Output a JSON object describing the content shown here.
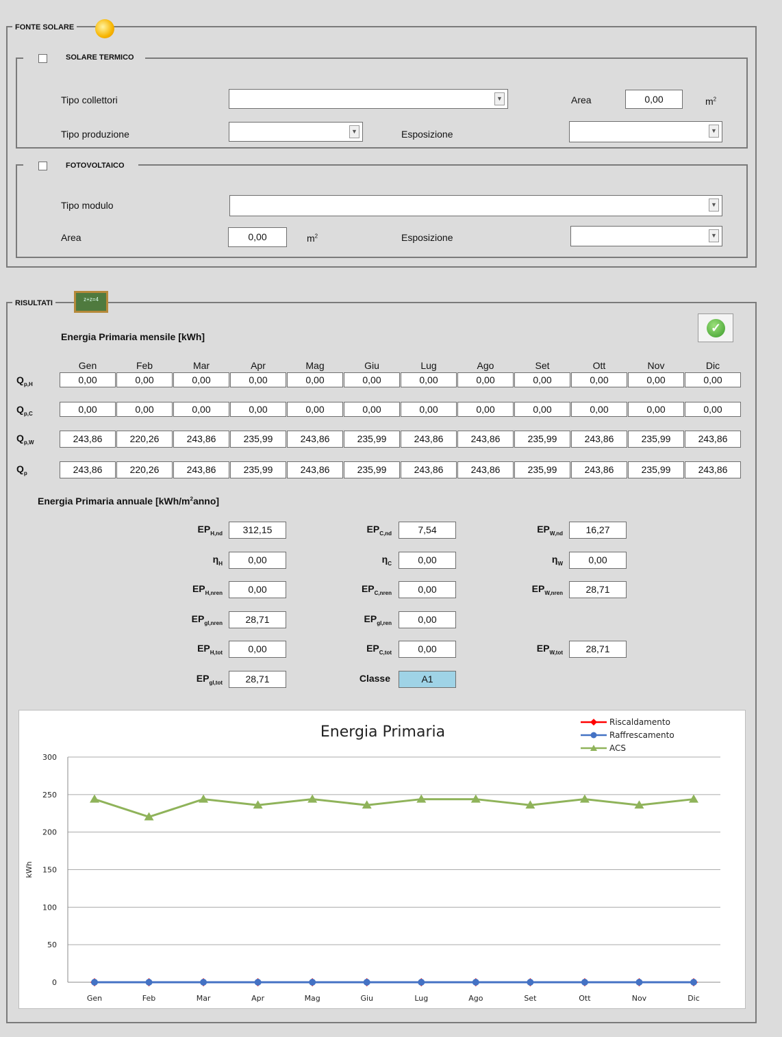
{
  "solar": {
    "section_label": "FONTE SOLARE",
    "termico": {
      "label": "SOLARE TERMICO",
      "tipo_collettori_label": "Tipo collettori",
      "tipo_produzione_label": "Tipo produzione",
      "area_label": "Area",
      "area_value": "0,00",
      "area_unit": "m",
      "esposizione_label": "Esposizione"
    },
    "fotovoltaico": {
      "label": "FOTOVOLTAICO",
      "tipo_modulo_label": "Tipo modulo",
      "area_label": "Area",
      "area_value": "0,00",
      "area_unit": "m",
      "esposizione_label": "Esposizione"
    }
  },
  "results": {
    "section_label": "RISULTATI",
    "monthly_title": "Energia Primaria mensile [kWh]",
    "months": [
      "Gen",
      "Feb",
      "Mar",
      "Apr",
      "Mag",
      "Giu",
      "Lug",
      "Ago",
      "Set",
      "Ott",
      "Nov",
      "Dic"
    ],
    "rows": [
      {
        "label": "Q",
        "sub": "p,H",
        "values": [
          "0,00",
          "0,00",
          "0,00",
          "0,00",
          "0,00",
          "0,00",
          "0,00",
          "0,00",
          "0,00",
          "0,00",
          "0,00",
          "0,00"
        ]
      },
      {
        "label": "Q",
        "sub": "p,C",
        "values": [
          "0,00",
          "0,00",
          "0,00",
          "0,00",
          "0,00",
          "0,00",
          "0,00",
          "0,00",
          "0,00",
          "0,00",
          "0,00",
          "0,00"
        ]
      },
      {
        "label": "Q",
        "sub": "p,W",
        "values": [
          "243,86",
          "220,26",
          "243,86",
          "235,99",
          "243,86",
          "235,99",
          "243,86",
          "243,86",
          "235,99",
          "243,86",
          "235,99",
          "243,86"
        ]
      },
      {
        "label": "Q",
        "sub": "p",
        "values": [
          "243,86",
          "220,26",
          "243,86",
          "235,99",
          "243,86",
          "235,99",
          "243,86",
          "243,86",
          "235,99",
          "243,86",
          "235,99",
          "243,86"
        ]
      }
    ],
    "annual_title_a": "Energia Primaria annuale [kWh/m",
    "annual_title_b": "anno]",
    "ep": {
      "h_nd": {
        "label": "EP",
        "sub": "H,nd",
        "value": "312,15"
      },
      "c_nd": {
        "label": "EP",
        "sub": "C,nd",
        "value": "7,54"
      },
      "w_nd": {
        "label": "EP",
        "sub": "W,nd",
        "value": "16,27"
      },
      "eta_h": {
        "label": "η",
        "sub": "H",
        "value": "0,00"
      },
      "eta_c": {
        "label": "η",
        "sub": "C",
        "value": "0,00"
      },
      "eta_w": {
        "label": "η",
        "sub": "W",
        "value": "0,00"
      },
      "h_nren": {
        "label": "EP",
        "sub": "H,nren",
        "value": "0,00"
      },
      "c_nren": {
        "label": "EP",
        "sub": "C,nren",
        "value": "0,00"
      },
      "w_nren": {
        "label": "EP",
        "sub": "W,nren",
        "value": "28,71"
      },
      "gl_nren": {
        "label": "EP",
        "sub": "gl,nren",
        "value": "28,71"
      },
      "gl_ren": {
        "label": "EP",
        "sub": "gl,ren",
        "value": "0,00"
      },
      "h_tot": {
        "label": "EP",
        "sub": "H,tot",
        "value": "0,00"
      },
      "c_tot": {
        "label": "EP",
        "sub": "C,tot",
        "value": "0,00"
      },
      "w_tot": {
        "label": "EP",
        "sub": "W,tot",
        "value": "28,71"
      },
      "gl_tot": {
        "label": "EP",
        "sub": "gl,tot",
        "value": "28,71"
      },
      "classe_label": "Classe",
      "classe_value": "A1"
    }
  },
  "chart_data": {
    "type": "line",
    "title": "Energia Primaria",
    "ylabel": "kWh",
    "xlabel": "",
    "categories": [
      "Gen",
      "Feb",
      "Mar",
      "Apr",
      "Mag",
      "Giu",
      "Lug",
      "Ago",
      "Set",
      "Ott",
      "Nov",
      "Dic"
    ],
    "ylim": [
      0,
      300
    ],
    "yticks": [
      0,
      50,
      100,
      150,
      200,
      250,
      300
    ],
    "grid": true,
    "legend_position": "top-right",
    "series": [
      {
        "name": "Riscaldamento",
        "color": "#ff0000",
        "marker": "diamond",
        "values": [
          0,
          0,
          0,
          0,
          0,
          0,
          0,
          0,
          0,
          0,
          0,
          0
        ]
      },
      {
        "name": "Raffrescamento",
        "color": "#4472c4",
        "marker": "circle",
        "values": [
          0,
          0,
          0,
          0,
          0,
          0,
          0,
          0,
          0,
          0,
          0,
          0
        ]
      },
      {
        "name": "ACS",
        "color": "#8fb35a",
        "marker": "triangle",
        "values": [
          243.86,
          220.26,
          243.86,
          235.99,
          243.86,
          235.99,
          243.86,
          243.86,
          235.99,
          243.86,
          235.99,
          243.86
        ]
      }
    ]
  }
}
